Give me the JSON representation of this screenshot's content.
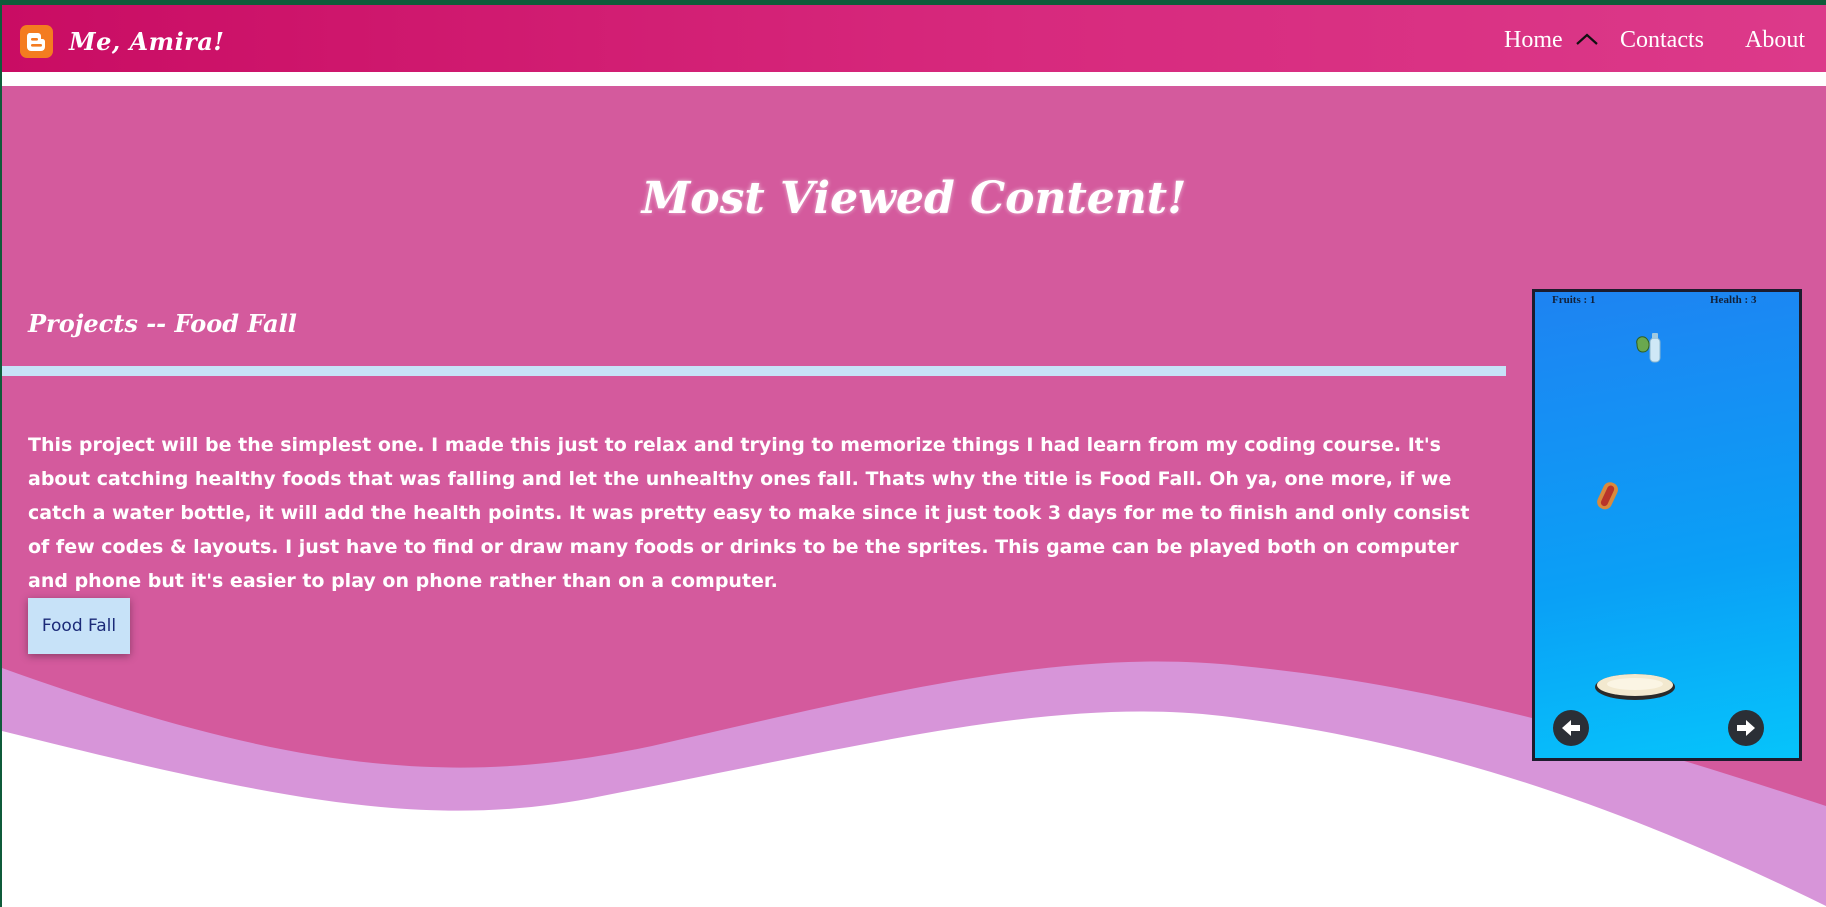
{
  "navbar": {
    "brand_name": "Me, Amira!",
    "brand_icon": "blogger-icon",
    "items": [
      {
        "label": "Home"
      },
      {
        "label": "Contacts"
      },
      {
        "label": "About"
      }
    ],
    "caret_icon": "chevron-up-icon"
  },
  "main": {
    "title": "Most Viewed Content!",
    "project_heading": "Projects -- Food Fall",
    "description": "This project will be the simplest one. I made this just to relax and trying to memorize things I had learn from my coding course. It's about catching healthy foods that was falling and let the unhealthy ones fall. Thats why the title is Food Fall. Oh ya, one more, if we catch a water bottle, it will add the health points. It was pretty easy to make since it just took 3 days for me to finish and only consist of few codes & layouts. I just have to find or draw many foods or drinks to be the sprites. This game can be played both on computer and phone but it's easier to play on phone rather than on a computer.",
    "button_label": "Food Fall"
  },
  "game_preview": {
    "fruits_label": "Fruits : 1",
    "health_label": "Health : 3",
    "left_arrow_icon": "arrow-left-icon",
    "right_arrow_icon": "arrow-right-icon"
  },
  "colors": {
    "navbar_start": "#c90c63",
    "navbar_end": "#dc3a8a",
    "content_bg": "#d45a9d",
    "divider": "#c7e2f8",
    "wave": "#d795d9",
    "game_bg": "#0aa0f6"
  }
}
